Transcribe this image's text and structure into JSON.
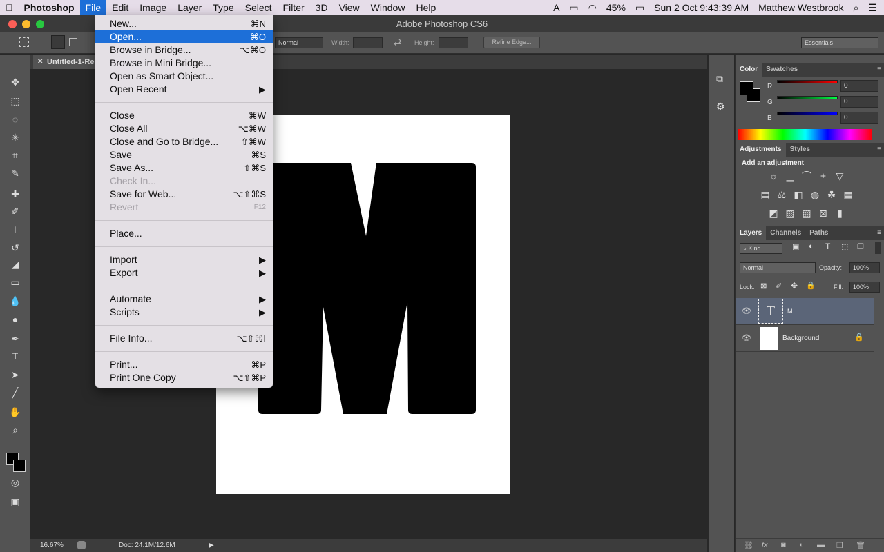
{
  "menubar": {
    "app": "Photoshop",
    "items": [
      "File",
      "Edit",
      "Image",
      "Layer",
      "Type",
      "Select",
      "Filter",
      "3D",
      "View",
      "Window",
      "Help"
    ],
    "battery": "45%",
    "datetime": "Sun 2 Oct  9:43:39 AM",
    "user": "Matthew Westbrook"
  },
  "window": {
    "title": "Adobe Photoshop CS6"
  },
  "options": {
    "style": "Normal",
    "width_label": "Width:",
    "height_label": "Height:",
    "refine": "Refine Edge...",
    "workspace": "Essentials"
  },
  "document": {
    "tab": "Untitled-1-Re",
    "letter": "M",
    "zoom": "16.67%",
    "doc_info": "Doc: 24.1M/12.6M"
  },
  "file_menu": [
    {
      "label": "New...",
      "shortcut": "⌘N"
    },
    {
      "label": "Open...",
      "shortcut": "⌘O",
      "highlighted": true
    },
    {
      "label": "Browse in Bridge...",
      "shortcut": "⌥⌘O"
    },
    {
      "label": "Browse in Mini Bridge...",
      "shortcut": ""
    },
    {
      "label": "Open as Smart Object...",
      "shortcut": ""
    },
    {
      "label": "Open Recent",
      "shortcut": "▶"
    },
    {
      "sep": true
    },
    {
      "label": "Close",
      "shortcut": "⌘W"
    },
    {
      "label": "Close All",
      "shortcut": "⌥⌘W"
    },
    {
      "label": "Close and Go to Bridge...",
      "shortcut": "⇧⌘W"
    },
    {
      "label": "Save",
      "shortcut": "⌘S"
    },
    {
      "label": "Save As...",
      "shortcut": "⇧⌘S"
    },
    {
      "label": "Check In...",
      "shortcut": "",
      "disabled": true
    },
    {
      "label": "Save for Web...",
      "shortcut": "⌥⇧⌘S"
    },
    {
      "label": "Revert",
      "shortcut": "F12",
      "disabled": true
    },
    {
      "sep": true
    },
    {
      "label": "Place...",
      "shortcut": ""
    },
    {
      "sep": true
    },
    {
      "label": "Import",
      "shortcut": "▶"
    },
    {
      "label": "Export",
      "shortcut": "▶"
    },
    {
      "sep": true
    },
    {
      "label": "Automate",
      "shortcut": "▶"
    },
    {
      "label": "Scripts",
      "shortcut": "▶"
    },
    {
      "sep": true
    },
    {
      "label": "File Info...",
      "shortcut": "⌥⇧⌘I"
    },
    {
      "sep": true
    },
    {
      "label": "Print...",
      "shortcut": "⌘P"
    },
    {
      "label": "Print One Copy",
      "shortcut": "⌥⇧⌘P"
    }
  ],
  "color_panel": {
    "tabs": [
      "Color",
      "Swatches"
    ],
    "channels": [
      {
        "name": "R",
        "value": "0",
        "color": "#ff0000"
      },
      {
        "name": "G",
        "value": "0",
        "color": "#00ff44"
      },
      {
        "name": "B",
        "value": "0",
        "color": "#0000ff"
      }
    ]
  },
  "adjustments_panel": {
    "tabs": [
      "Adjustments",
      "Styles"
    ],
    "heading": "Add an adjustment"
  },
  "layers_panel": {
    "tabs": [
      "Layers",
      "Channels",
      "Paths"
    ],
    "filter": "Kind",
    "blend": "Normal",
    "opacity_label": "Opacity:",
    "opacity": "100%",
    "lock_label": "Lock:",
    "fill_label": "Fill:",
    "fill": "100%",
    "layers": [
      {
        "name": "M",
        "type": "text",
        "selected": true
      },
      {
        "name": "Background",
        "type": "image",
        "locked": true
      }
    ]
  }
}
